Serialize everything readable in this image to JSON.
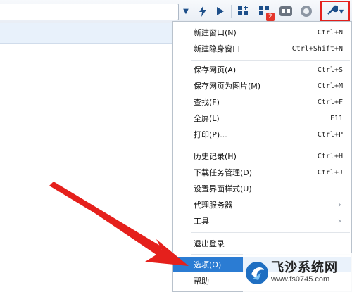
{
  "menu": {
    "items": [
      {
        "label": "新建窗口(N)",
        "shortcut": "Ctrl+N"
      },
      {
        "label": "新建隐身窗口",
        "shortcut": "Ctrl+Shift+N"
      },
      {
        "label": "保存网页(A)",
        "shortcut": "Ctrl+S"
      },
      {
        "label": "保存网页为图片(M)",
        "shortcut": "Ctrl+M"
      },
      {
        "label": "查找(F)",
        "shortcut": "Ctrl+F"
      },
      {
        "label": "全屏(L)",
        "shortcut": "F11"
      },
      {
        "label": "打印(P)...",
        "shortcut": "Ctrl+P"
      },
      {
        "label": "历史记录(H)",
        "shortcut": "Ctrl+H"
      },
      {
        "label": "下载任务管理(D)",
        "shortcut": "Ctrl+J"
      },
      {
        "label": "设置界面样式(U)",
        "shortcut": ""
      },
      {
        "label": "代理服务器",
        "shortcut": ""
      },
      {
        "label": "工具",
        "shortcut": ""
      },
      {
        "label": "退出登录",
        "shortcut": ""
      },
      {
        "label": "选项(O)",
        "shortcut": ""
      },
      {
        "label": "帮助",
        "shortcut": ""
      }
    ]
  },
  "toolbar": {
    "badge_count": "2",
    "icons": [
      "dropdown-icon",
      "lightning-icon",
      "play-icon",
      "apps-icon",
      "extensions-icon",
      "reader-icon",
      "shield-icon",
      "wrench-icon"
    ]
  },
  "watermark": {
    "title": "飞沙系统网",
    "url": "www.fs0745.com"
  },
  "colors": {
    "highlight": "#2b7cd3",
    "annotation_red": "#e5201c"
  }
}
